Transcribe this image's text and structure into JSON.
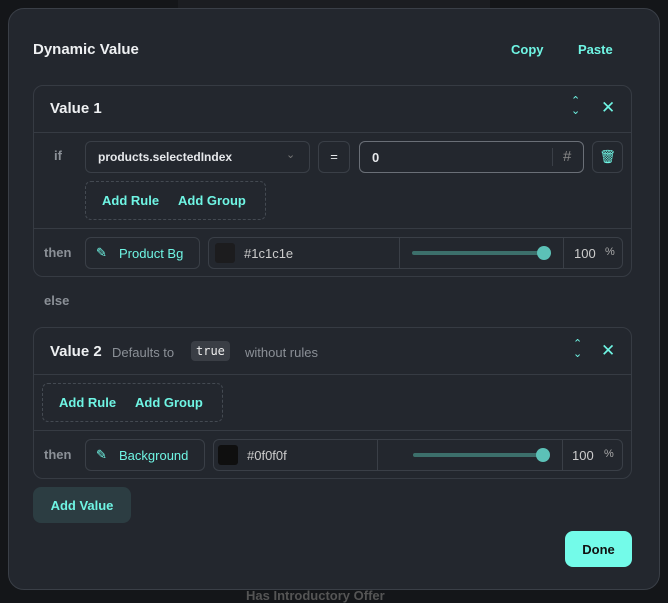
{
  "background": {
    "text": "Has Introductory Offer"
  },
  "modal": {
    "title": "Dynamic Value",
    "copy": "Copy",
    "paste": "Paste",
    "values": [
      {
        "title": "Value 1",
        "if_label": "if",
        "condition": {
          "field": "products.selectedIndex",
          "operator": "=",
          "value": "0",
          "value_type_icon": "#"
        },
        "add_rule": "Add Rule",
        "add_group": "Add Group",
        "then_label": "then",
        "variable": "Product Bg",
        "color": "#1c1c1e",
        "opacity": "100",
        "percent": "%",
        "opacity_fraction": 1.0
      },
      {
        "title": "Value 2",
        "defaults_prefix": "Defaults to",
        "defaults_value": "true",
        "defaults_suffix": "without rules",
        "add_rule": "Add Rule",
        "add_group": "Add Group",
        "then_label": "then",
        "variable": "Background",
        "color": "#0f0f0f",
        "opacity": "100",
        "percent": "%",
        "opacity_fraction": 1.0
      }
    ],
    "else_label": "else",
    "add_value": "Add Value",
    "done": "Done"
  },
  "colors": {
    "accent": "#6ff5e4",
    "panel": "#23272e"
  }
}
